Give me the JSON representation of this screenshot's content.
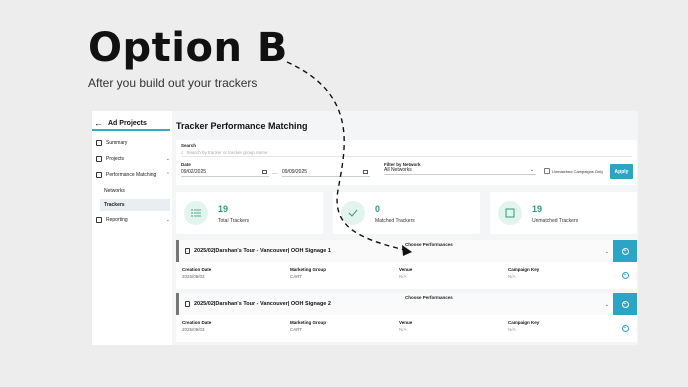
{
  "hero": {
    "title": "Option B",
    "subtitle": "After you build out your trackers"
  },
  "colors": {
    "accent": "#2ca4c6",
    "stat_green": "#2f9e77"
  },
  "sidebar": {
    "title": "Ad Projects",
    "items": [
      {
        "label": "Summary",
        "icon": "summary-icon"
      },
      {
        "label": "Projects",
        "icon": "projects-icon"
      },
      {
        "label": "Performance Matching",
        "icon": "performance-matching-icon"
      },
      {
        "label": "Reporting",
        "icon": "reporting-icon"
      }
    ],
    "subitems": [
      {
        "label": "Networks"
      },
      {
        "label": "Trackers"
      }
    ]
  },
  "main": {
    "title": "Tracker Performance Matching",
    "filters": {
      "search_label": "Search",
      "search_placeholder": "Search by tracker or tracker group name",
      "date_label": "Date",
      "date_from": "09/02/2025",
      "date_separator": "—",
      "date_to": "09/09/2025",
      "network_label": "Filter by Network",
      "network_value": "All Networks",
      "unmatched_only_label": "Unmatched Campaigns Only",
      "apply_label": "Apply"
    },
    "stats": [
      {
        "value": "19",
        "label": "Total Trackers",
        "icon": "list-icon"
      },
      {
        "value": "0",
        "label": "Matched Trackers",
        "icon": "check-icon"
      },
      {
        "value": "19",
        "label": "Unmatched Trackers",
        "icon": "square-icon"
      }
    ],
    "trackers": [
      {
        "name": "2025/02|Darshan's Tour - Vancouver| OOH Signage 1",
        "choose_label": "Choose Performances",
        "columns": [
          {
            "header": "Creation Date",
            "value": "2025/09/03"
          },
          {
            "header": "Marketing Group",
            "value": "CART"
          },
          {
            "header": "Venue",
            "value": "N/A"
          },
          {
            "header": "Campaign Key",
            "value": "N/A"
          }
        ]
      },
      {
        "name": "2025/02|Darshan's Tour - Vancouver| OOH Signage 2",
        "choose_label": "Choose Performances",
        "columns": [
          {
            "header": "Creation Date",
            "value": "2025/09/03"
          },
          {
            "header": "Marketing Group",
            "value": "CART"
          },
          {
            "header": "Venue",
            "value": "N/A"
          },
          {
            "header": "Campaign Key",
            "value": "N/A"
          }
        ]
      }
    ]
  }
}
